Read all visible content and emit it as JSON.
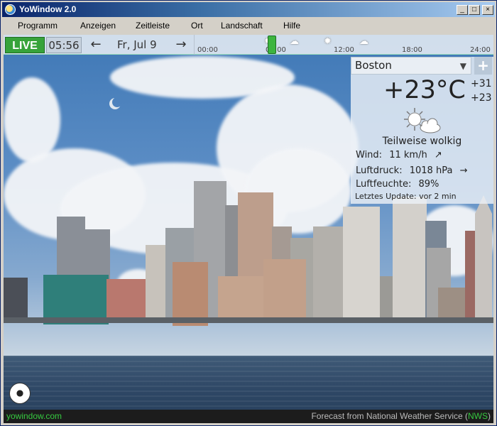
{
  "window": {
    "title": "YoWindow 2.0",
    "min_label": "_",
    "max_label": "□",
    "close_label": "×"
  },
  "menu": {
    "items": [
      "Programm",
      "Anzeigen",
      "Zeitleiste",
      "Ort",
      "Landschaft",
      "Hilfe"
    ]
  },
  "timebar": {
    "live_label": "LIVE",
    "time": "05:56",
    "prev_arrow": "←",
    "next_arrow": "→",
    "date": "Fr, Jul 9",
    "ticks": [
      "00:00",
      "06:00",
      "12:00",
      "18:00",
      "24:00"
    ]
  },
  "weather": {
    "city": "Boston",
    "dropdown_caret": "▼",
    "add_label": "+",
    "temperature": "+23°C",
    "high": "+31",
    "low": "+23",
    "condition": "Teilweise wolkig",
    "wind_label": "Wind:",
    "wind_value": "11 km/h",
    "wind_arrow": "↗",
    "pressure_label": "Luftdruck:",
    "pressure_value": "1018 hPa",
    "pressure_arrow": "→",
    "humidity_label": "Luftfeuchte:",
    "humidity_value": "89%",
    "update_text": "Letztes Update: vor 2 min"
  },
  "footer": {
    "site": "yowindow.com",
    "forecast_prefix": "Forecast from National Weather Service (",
    "forecast_source": "NWS",
    "forecast_suffix": ")"
  },
  "icons": {
    "weather": "partly-cloudy-icon",
    "ball": "soccer-ball-icon",
    "moon": "moon-icon"
  }
}
